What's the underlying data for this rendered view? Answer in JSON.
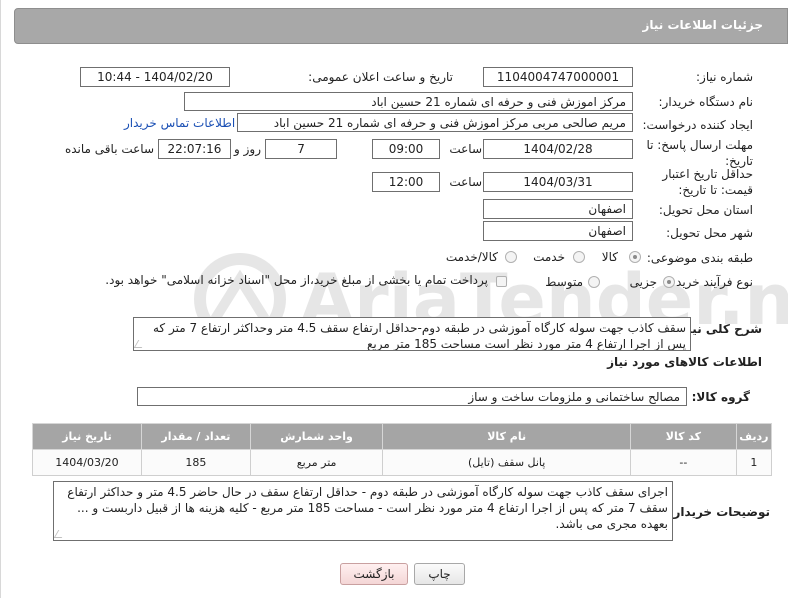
{
  "header": {
    "title": "جزئیات اطلاعات نیاز"
  },
  "fields": {
    "need_number_label": "شماره نیاز:",
    "need_number": "1104004747000001",
    "announce_label": "تاریخ و ساعت اعلان عمومی:",
    "announce_value": "1404/02/20 - 10:44",
    "buyer_org_label": "نام دستگاه خریدار:",
    "buyer_org": "مرکز اموزش فنی و حرفه ای شماره 21 حسین اباد",
    "creator_label": "ایجاد کننده درخواست:",
    "creator": "مریم صالحی مربی مرکز اموزش فنی و حرفه ای شماره 21 حسین اباد",
    "contact_link": "اطلاعات تماس خریدار",
    "reply_deadline_label": "مهلت ارسال پاسخ: تا تاریخ:",
    "reply_date": "1404/02/28",
    "time_label": "ساعت",
    "reply_time": "09:00",
    "days_value": "7",
    "days_label": "روز و",
    "remaining_time": "22:07:16",
    "remaining_label": "ساعت باقی مانده",
    "price_validity_label": "حداقل تاریخ اعتبار قیمت: تا تاریخ:",
    "price_date": "1404/03/31",
    "price_time": "12:00",
    "province_label": "استان محل تحویل:",
    "province": "اصفهان",
    "city_label": "شهر محل تحویل:",
    "city": "اصفهان",
    "category_label": "طبقه بندی موضوعی:",
    "category_options": [
      "کالا",
      "خدمت",
      "کالا/خدمت"
    ],
    "process_label": "نوع فرآیند خرید :",
    "process_options": [
      "جزیی",
      "متوسط"
    ],
    "payment_note": "پرداخت تمام یا بخشی از مبلغ خرید،از محل \"اسناد خزانه اسلامی\" خواهد بود."
  },
  "description": {
    "label": "شرح کلی نیاز:",
    "text": "سقف کاذب جهت سوله کارگاه آموزشی در طبقه دوم-حداقل ارتفاع سقف 4.5 متر وحداکثر ارتفاع  7 متر که پس از اجرا ارتفاع 4 متر مورد نظر است مساحت 185 متر مربع"
  },
  "goods": {
    "section_title": "اطلاعات کالاهای مورد نیاز",
    "group_label": "گروه کالا:",
    "group_value": "مصالح ساختمانی و ملزومات ساخت و ساز",
    "columns": [
      "ردیف",
      "کد کالا",
      "نام کالا",
      "واحد شمارش",
      "تعداد / مقدار",
      "تاریخ نیاز"
    ],
    "rows": [
      [
        "1",
        "--",
        "پانل سقف (تایل)",
        "متر مربع",
        "185",
        "1404/03/20"
      ]
    ]
  },
  "buyer_notes": {
    "label": "توضیحات خریدار:",
    "text": "اجرای سقف کاذب جهت سوله کارگاه آموزشی در طبقه دوم - حداقل ارتفاع سقف در حال حاضر 4.5 متر و حداکثر ارتفاع سقف 7 متر که پس از اجرا ارتفاع 4 متر مورد نظر است  - مساحت 185 متر مربع - کلیه هزینه ها از قبیل داربست و ... بعهده مجری می باشد."
  },
  "buttons": {
    "print": "چاپ",
    "back": "بازگشت"
  },
  "watermark": {
    "text": "AriaTender.neT"
  },
  "colors": {
    "header": "#a8a8a8",
    "link": "#1a4fb4",
    "back_button": "#f4d6d6"
  }
}
